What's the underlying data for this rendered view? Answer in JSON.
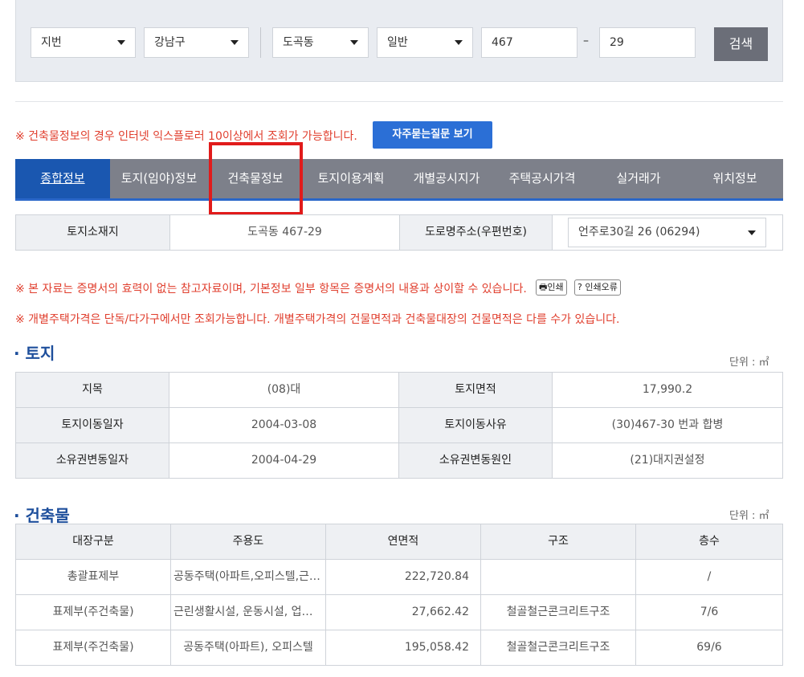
{
  "search": {
    "type_select": "지번",
    "gu_select": "강남구",
    "dong_select": "도곡동",
    "kind_select": "일반",
    "main_number": "467",
    "dash": "–",
    "sub_number": "29",
    "search_button": "검색"
  },
  "notice_ie": "※ 건축물정보의 경우 인터넷 익스플로러 10이상에서 조회가 가능합니다.",
  "faq_button": "자주묻는질문 보기",
  "tabs": [
    {
      "label": "종합정보",
      "active": true
    },
    {
      "label": "토지(임야)정보"
    },
    {
      "label": "건축물정보"
    },
    {
      "label": "토지이용계획"
    },
    {
      "label": "개별공시지가"
    },
    {
      "label": "주택공시가격"
    },
    {
      "label": "실거래가"
    },
    {
      "label": "위치정보"
    }
  ],
  "address": {
    "land_location_label": "토지소재지",
    "land_location_value": "도곡동 467-29",
    "road_address_label": "도로명주소(우편번호)",
    "road_address_value": "언주로30길 26 (06294)"
  },
  "notice_reference": "※ 본 자료는 증명서의 효력이 없는 참고자료이며, 기본정보 일부 항목은 증명서의 내용과 상이할 수 있습니다.",
  "print_button": "인쇄",
  "print_error_button": "? 인쇄오류",
  "notice_house": "※ 개별주택가격은 단독/다가구에서만 조회가능합니다. 개별주택가격의 건물면적과 건축물대장의 건물면적은 다를 수가 있습니다.",
  "land": {
    "title": "· 토지",
    "unit": "단위 : ㎡",
    "rows": [
      {
        "l1": "지목",
        "v1": "(08)대",
        "l2": "토지면적",
        "v2": "17,990.2"
      },
      {
        "l1": "토지이동일자",
        "v1": "2004-03-08",
        "l2": "토지이동사유",
        "v2": "(30)467-30 번과 합병"
      },
      {
        "l1": "소유권변동일자",
        "v1": "2004-04-29",
        "l2": "소유권변동원인",
        "v2": "(21)대지권설정"
      }
    ]
  },
  "building": {
    "title": "· 건축물",
    "unit": "단위 : ㎡",
    "headers": [
      "대장구분",
      "주용도",
      "연면적",
      "구조",
      "층수"
    ],
    "rows": [
      [
        "총괄표제부",
        "공동주택(아파트,오피스텔,근…",
        "222,720.84",
        "",
        "/"
      ],
      [
        "표제부(주건축물)",
        "근린생활시설, 운동시설, 업…",
        "27,662.42",
        "철골철근콘크리트구조",
        "7/6"
      ],
      [
        "표제부(주건축물)",
        "공동주택(아파트), 오피스텔",
        "195,058.42",
        "철골철근콘크리트구조",
        "69/6"
      ]
    ]
  },
  "colors": {
    "tab_bg": "#7d808a",
    "tab_active": "#1a57b0",
    "notice_red": "#e03e2d",
    "highlight_red": "#e11b1b",
    "faq_blue": "#2b6fd6"
  }
}
